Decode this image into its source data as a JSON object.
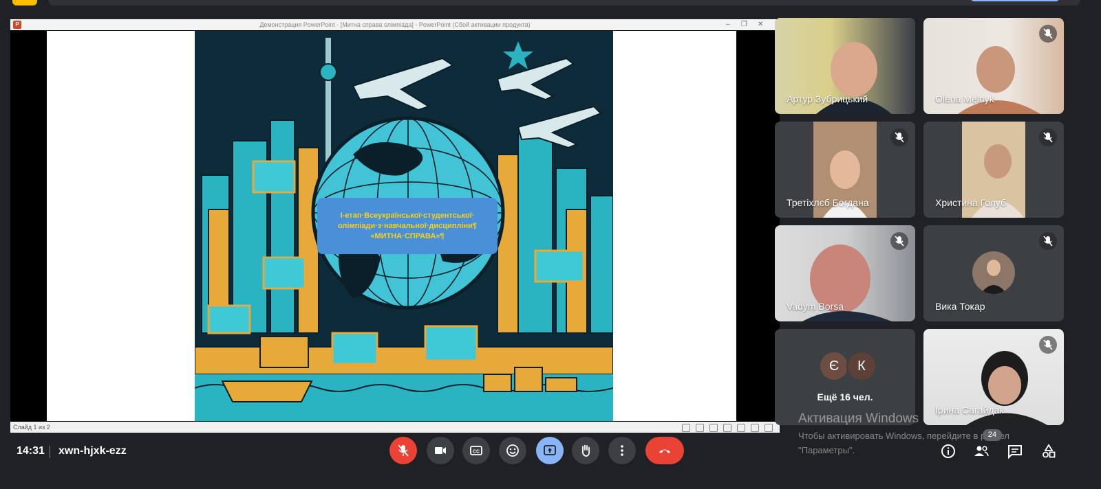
{
  "presentation": {
    "window_title": "Демонстрация PowerPoint - [Митна справа олімпіада] - PowerPoint (Сбой активации продукта)",
    "slide_counter": "Слайд 1 из 2",
    "slide_caption_line1": "І-етап·Всеукраїнської·студентської·",
    "slide_caption_line2": "олімпіади·з·навчальної·дисципліни¶",
    "slide_caption_line3": "«МИТНА·СПРАВА»¶"
  },
  "participants": [
    {
      "name": "Артур Зубрицький",
      "muted": false
    },
    {
      "name": "Olena Melnyk",
      "muted": true
    },
    {
      "name": "Третіхлєб Богдана",
      "muted": true
    },
    {
      "name": "Христина Голуб",
      "muted": true
    },
    {
      "name": "Vadym Borsa",
      "muted": true
    },
    {
      "name": "Вика Токар",
      "muted": true
    },
    {
      "name": "Ірина Сагайдак",
      "muted": true
    }
  ],
  "more": {
    "letters": [
      "Є",
      "К"
    ],
    "label": "Ещё 16 чел."
  },
  "windows_activation": {
    "title": "Активация Windows",
    "subtitle": "Чтобы активировать Windows, перейдите в раздел \"Параметры\"."
  },
  "bottom_bar": {
    "time": "14:31",
    "meeting_code": "xwn-hjxk-ezz",
    "participants_count": "24"
  },
  "colors": {
    "background": "#202124",
    "tile": "#3c4043",
    "danger": "#ea4335",
    "accent": "#8ab4f8"
  }
}
